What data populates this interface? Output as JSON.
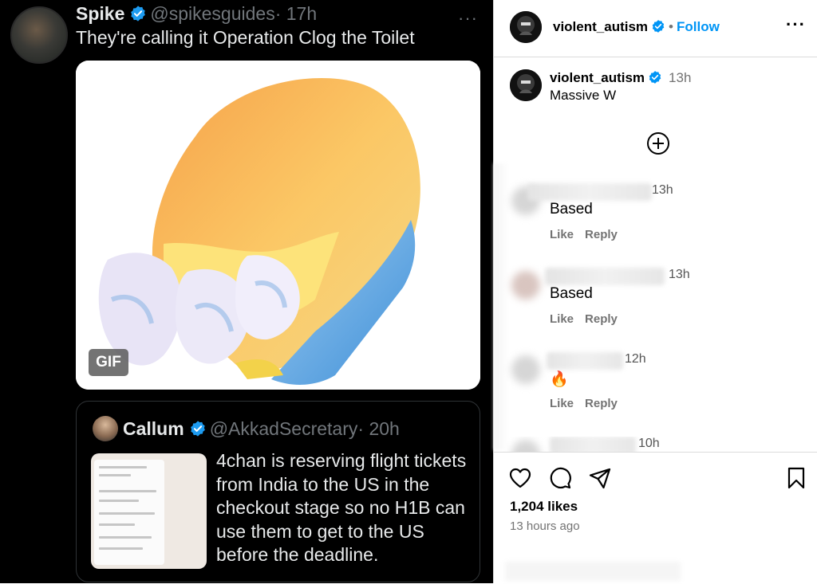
{
  "tweet": {
    "name": "Spike",
    "handle": "@spikesguides",
    "time": "· 17h",
    "more": "···",
    "text": "They're calling it Operation Clog the Toilet",
    "gif_badge": "GIF",
    "quote": {
      "name": "Callum",
      "handle": "@AkkadSecretary",
      "time": "· 20h",
      "text": "4chan is reserving flight tickets from India to the US in the checkout stage so no H1B can use them to get to the US before the deadline."
    }
  },
  "instagram": {
    "header": {
      "username": "violent_autism",
      "dot": "•",
      "follow_label": "Follow",
      "more": "···"
    },
    "post": {
      "username": "violent_autism",
      "time": "13h",
      "caption": "Massive W"
    },
    "comments": [
      {
        "time": "13h",
        "text": "Based",
        "like": "Like",
        "reply": "Reply"
      },
      {
        "time": "13h",
        "text": "Based",
        "like": "Like",
        "reply": "Reply"
      },
      {
        "time": "12h",
        "text": "🔥",
        "like": "Like",
        "reply": "Reply"
      },
      {
        "time": "10h"
      }
    ],
    "likes": "1,204 likes",
    "time_ago": "13 hours ago"
  },
  "colors": {
    "twitter_bg": "#000000",
    "twitter_text": "#e7e9ea",
    "twitter_muted": "#71767b",
    "verified_blue": "#1d9bf0",
    "ig_blue": "#0095f6",
    "ig_muted": "#737373"
  },
  "icons": [
    "verified-badge-icon",
    "more-icon",
    "gif-badge",
    "add-comment-icon",
    "heart-icon",
    "comment-icon",
    "share-icon",
    "bookmark-icon"
  ]
}
